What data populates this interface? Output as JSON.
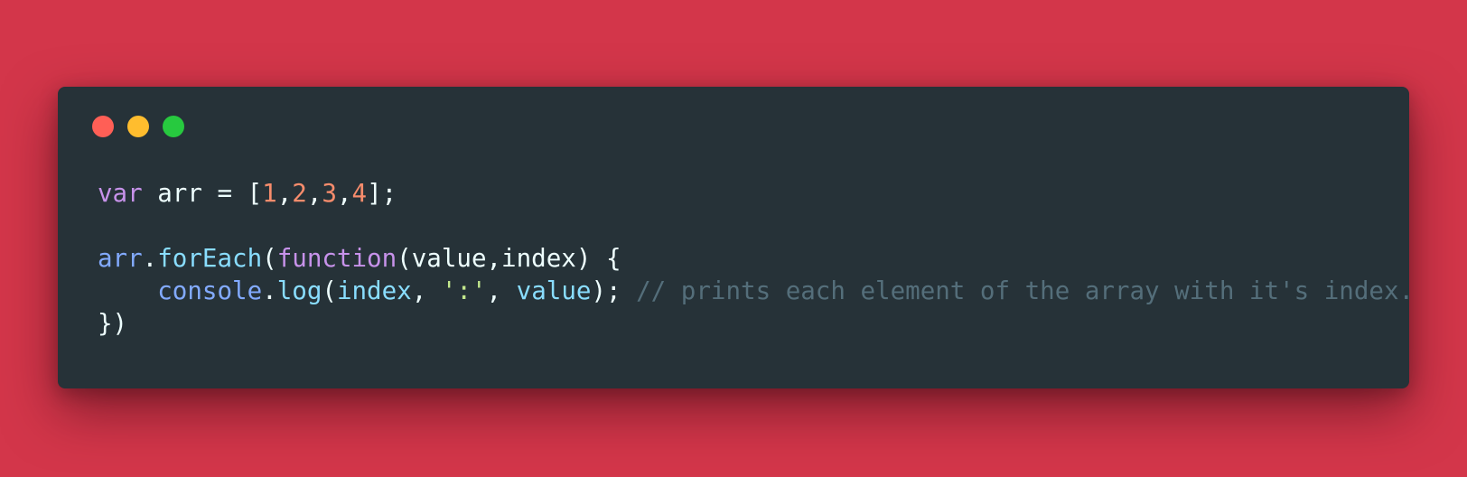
{
  "window": {
    "controls": [
      {
        "name": "close",
        "color": "#ff5f56"
      },
      {
        "name": "minimize",
        "color": "#ffbd2e"
      },
      {
        "name": "maximize",
        "color": "#27c93f"
      }
    ]
  },
  "colors": {
    "background": "#d3364a",
    "editor_background": "#263238",
    "plain": "#eeffff",
    "keyword": "#c792ea",
    "number": "#f78c6c",
    "variable": "#82aaff",
    "method": "#89ddff",
    "string": "#c3e88d",
    "comment": "#546e7a"
  },
  "code": {
    "lines": [
      [
        {
          "text": "var",
          "type": "keyword"
        },
        {
          "text": " arr = [",
          "type": "plain"
        },
        {
          "text": "1",
          "type": "number"
        },
        {
          "text": ",",
          "type": "plain"
        },
        {
          "text": "2",
          "type": "number"
        },
        {
          "text": ",",
          "type": "plain"
        },
        {
          "text": "3",
          "type": "number"
        },
        {
          "text": ",",
          "type": "plain"
        },
        {
          "text": "4",
          "type": "number"
        },
        {
          "text": "];",
          "type": "plain"
        }
      ],
      [],
      [
        {
          "text": "arr",
          "type": "variable"
        },
        {
          "text": ".",
          "type": "plain"
        },
        {
          "text": "forEach",
          "type": "method"
        },
        {
          "text": "(",
          "type": "plain"
        },
        {
          "text": "function",
          "type": "keyword"
        },
        {
          "text": "(value,index) {",
          "type": "plain"
        }
      ],
      [
        {
          "text": "    ",
          "type": "plain"
        },
        {
          "text": "console",
          "type": "variable"
        },
        {
          "text": ".",
          "type": "plain"
        },
        {
          "text": "log",
          "type": "method"
        },
        {
          "text": "(",
          "type": "plain"
        },
        {
          "text": "index",
          "type": "method"
        },
        {
          "text": ", ",
          "type": "plain"
        },
        {
          "text": "':'",
          "type": "string"
        },
        {
          "text": ", ",
          "type": "plain"
        },
        {
          "text": "value",
          "type": "method"
        },
        {
          "text": "); ",
          "type": "plain"
        },
        {
          "text": "// prints each element of the array with it's index.",
          "type": "comment"
        }
      ],
      [
        {
          "text": "})",
          "type": "plain"
        }
      ]
    ]
  }
}
